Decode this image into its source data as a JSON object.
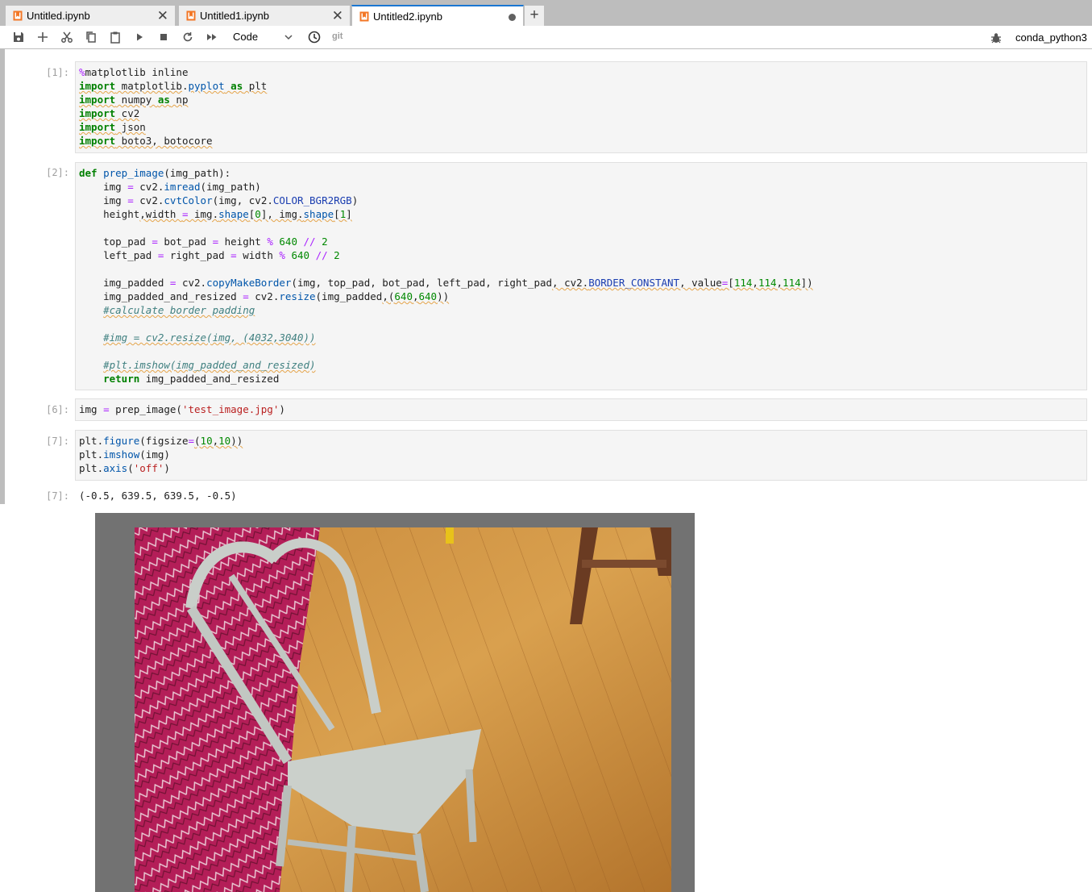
{
  "tabs": [
    {
      "label": "Untitled.ipynb",
      "active": false,
      "dirty": false
    },
    {
      "label": "Untitled1.ipynb",
      "active": false,
      "dirty": false
    },
    {
      "label": "Untitled2.ipynb",
      "active": true,
      "dirty": true
    }
  ],
  "toolbar": {
    "cell_type": "Code",
    "git_label": "git",
    "kernel": "conda_python3"
  },
  "cells": [
    {
      "prompt": "[1]:"
    },
    {
      "prompt": "[2]:"
    },
    {
      "prompt": "[6]:"
    },
    {
      "prompt": "[7]:"
    }
  ],
  "output": {
    "prompt": "[7]:",
    "text": "(-0.5, 639.5, 639.5, -0.5)"
  },
  "colors": {
    "accent": "#1976d2",
    "keyword": "#008000",
    "operator": "#aa22ff",
    "string": "#ba2121",
    "comment": "#408080",
    "figure_border": "#727272"
  }
}
